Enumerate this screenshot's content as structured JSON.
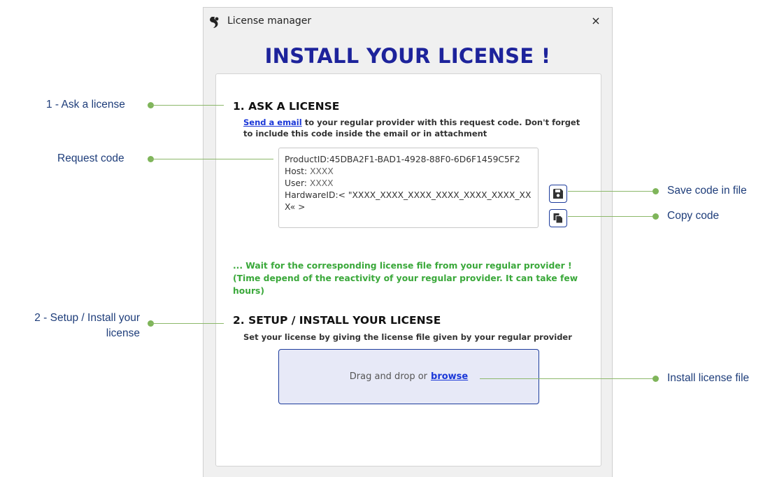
{
  "window": {
    "title": "License manager",
    "close_symbol": "×",
    "heading": "INSTALL YOUR LICENSE !"
  },
  "step1": {
    "heading": "1. ASK A LICENSE",
    "link": "Send a email",
    "desc": " to your regular provider with this request code. Don't forget to include this code inside the email or in attachment"
  },
  "request_code": {
    "product_label": "ProductID:",
    "product_value": "45DBA2F1-BAD1-4928-88F0-6D6F1459C5F2",
    "host_label": "Host:",
    "host_value": "XXXX",
    "user_label": "User:",
    "user_value": "XXXX",
    "hw_label": "HardwareID:",
    "hw_value": "< \"XXXX_XXXX_XXXX_XXXX_XXXX_XXXX_XXX« >"
  },
  "wait_text": "... Wait for the corresponding license file from your regular provider ! (Time depend of the reactivity of your regular provider. It can take few hours)",
  "step2": {
    "heading": "2. SETUP / INSTALL YOUR LICENSE",
    "desc": "Set your license by giving the license file given by your regular provider"
  },
  "dropzone": {
    "text": "Drag and drop or",
    "link": "browse"
  },
  "callouts": {
    "ask": "1 - Ask a license",
    "request": "Request code",
    "setup_line1": "2 - Setup / Install your",
    "setup_line2": "license",
    "save": "Save code in file",
    "copy": "Copy code",
    "install": "Install license file"
  },
  "colors": {
    "heading": "#1d239b",
    "link": "#1a37d8",
    "wait": "#3aa83a",
    "callout_text": "#1e3d7a",
    "callout_line": "#8cb86a",
    "dropzone_bg": "#e7e9f7"
  },
  "icons": {
    "app": "app-logo-icon",
    "save": "floppy-disk-icon",
    "copy": "copy-documents-icon"
  }
}
